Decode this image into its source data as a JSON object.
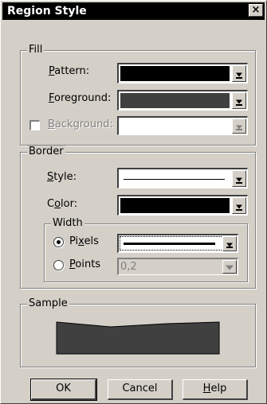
{
  "window": {
    "title": "Region Style",
    "close_glyph": "×"
  },
  "fill": {
    "legend": "Fill",
    "pattern": {
      "label_u": "P",
      "label_rest": "attern:",
      "color": "#000000"
    },
    "foreground": {
      "label_u": "F",
      "label_rest": "oreground:",
      "color": "#404040"
    },
    "background": {
      "label_u": "B",
      "label_rest": "ackground:",
      "checked": false,
      "enabled": false,
      "color": "#ffffff"
    }
  },
  "border": {
    "legend": "Border",
    "style": {
      "label_u": "S",
      "label_rest": "tyle:",
      "line": "solid"
    },
    "color": {
      "label_pre": "C",
      "label_u": "o",
      "label_rest": "lor:",
      "color": "#000000"
    },
    "width": {
      "legend": "Width",
      "pixels": {
        "label_pre": "Pi",
        "label_u": "x",
        "label_rest": "els",
        "selected": true
      },
      "points": {
        "label_u": "P",
        "label_rest": "oints",
        "selected": false,
        "value": "0,2"
      }
    }
  },
  "sample": {
    "legend": "Sample",
    "fill": "#404040"
  },
  "buttons": {
    "ok": "OK",
    "cancel": "Cancel",
    "help_u": "H",
    "help_rest": "elp"
  },
  "colors": {
    "face": "#d4d0c8",
    "titlebar": "#000000"
  }
}
